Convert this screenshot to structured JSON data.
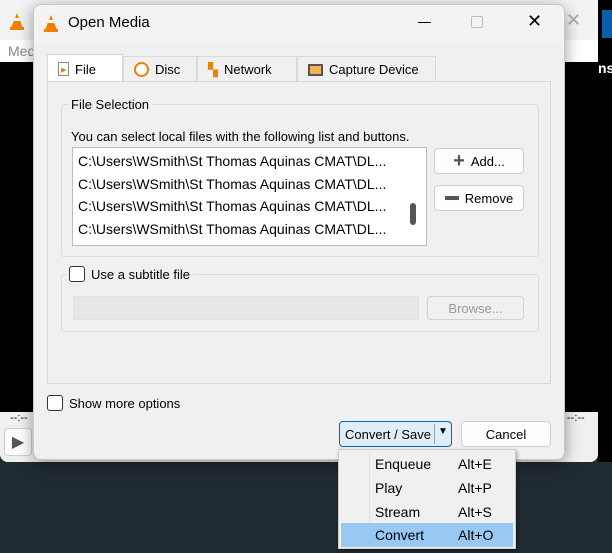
{
  "background_window": {
    "menu_partial": "Med",
    "right_partial": "ns",
    "time_left": "--:--",
    "time_right": "--:--"
  },
  "dialog": {
    "title": "Open Media",
    "tabs": [
      {
        "label": "File",
        "icon": "file-icon",
        "selected": true
      },
      {
        "label": "Disc",
        "icon": "disc-icon"
      },
      {
        "label": "Network",
        "icon": "network-icon"
      },
      {
        "label": "Capture Device",
        "icon": "capture-device-icon"
      }
    ],
    "file_selection": {
      "legend": "File Selection",
      "description": "You can select local files with the following list and buttons.",
      "files": [
        "C:\\Users\\WSmith\\St Thomas Aquinas CMAT\\DL...",
        "C:\\Users\\WSmith\\St Thomas Aquinas CMAT\\DL...",
        "C:\\Users\\WSmith\\St Thomas Aquinas CMAT\\DL...",
        "C:\\Users\\WSmith\\St Thomas Aquinas CMAT\\DL..."
      ],
      "add_label": "Add...",
      "remove_label": "Remove"
    },
    "subtitle": {
      "label": "Use a subtitle file",
      "checked": false,
      "value": "",
      "browse_label": "Browse..."
    },
    "show_more_options": {
      "label": "Show more options",
      "checked": false
    },
    "convert_save_label": "Convert / Save",
    "cancel_label": "Cancel"
  },
  "dropdown_menu": {
    "items": [
      {
        "label": "Enqueue",
        "shortcut": "Alt+E"
      },
      {
        "label": "Play",
        "shortcut": "Alt+P"
      },
      {
        "label": "Stream",
        "shortcut": "Alt+S"
      },
      {
        "label": "Convert",
        "shortcut": "Alt+O",
        "highlighted": true
      }
    ]
  },
  "colors": {
    "highlight": "#99c9f3",
    "accent": "#0067c0",
    "vlc_orange": "#f08000"
  }
}
